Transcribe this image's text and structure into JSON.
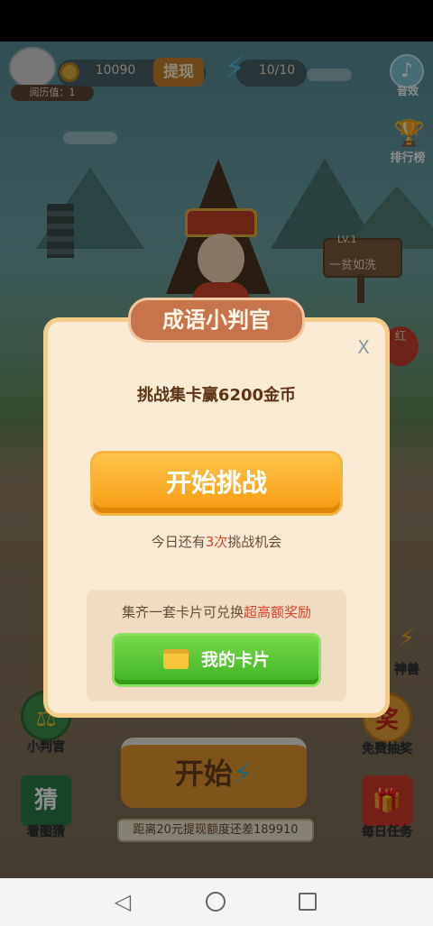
{
  "hud": {
    "read_value_label": "阅历值：1",
    "coins": "10090",
    "withdraw_label": "提现",
    "energy": "10/10",
    "sound_label": "音效",
    "rank_label": "排行榜"
  },
  "scene": {
    "sign_level": "LV.1",
    "sign_text": "一贫如洗",
    "red_badge": "红"
  },
  "side": {
    "judge_label": "小判官",
    "guess_label": "看图猜",
    "guess_icon_text": "猜",
    "beast_label": "神兽",
    "lottery_label": "免费抽奖",
    "lottery_icon_text": "奖",
    "daily_label": "每日任务"
  },
  "main": {
    "start_label": "开始",
    "progress_note": "距离20元提现额度还差189910"
  },
  "modal": {
    "title": "成语小判官",
    "close_label": "X",
    "challenge_text": "挑战集卡赢6200金币",
    "start_challenge_label": "开始挑战",
    "chances_prefix": "今日还有",
    "chances_count": "3次",
    "chances_suffix": "挑战机会",
    "card_tip_prefix": "集齐一套卡片可兑换",
    "card_tip_highlight": "超高额奖励",
    "my_cards_label": "我的卡片"
  },
  "colors": {
    "accent_orange": "#f59a10",
    "accent_green": "#3db422",
    "highlight_red": "#d9452b",
    "modal_bg": "#f8ead3"
  },
  "icons": {
    "coin": "coin-icon",
    "energy": "lightning-icon",
    "sound": "music-note-icon",
    "rank": "trophy-icon",
    "folder": "folder-icon"
  }
}
